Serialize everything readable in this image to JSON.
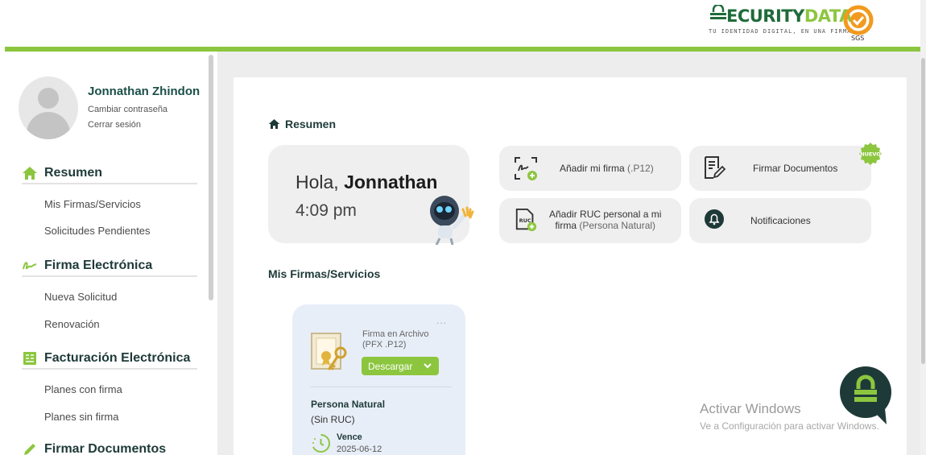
{
  "header": {
    "logo_part1": "ECURITY",
    "logo_part2": "DATA",
    "logo_tagline": "TU IDENTIDAD DIGITAL, EN UNA FIRMA.",
    "cert_badge": "SGS",
    "brand_green": "#8cc63f",
    "brand_dark": "#1f6b3a"
  },
  "user": {
    "name": "Jonnathan Zhindon",
    "change_password": "Cambiar contraseña",
    "logout": "Cerrar sesión"
  },
  "sidebar": {
    "sections": [
      {
        "label": "Resumen",
        "icon": "home-icon",
        "items": [
          "Mis Firmas/Servicios",
          "Solicitudes Pendientes"
        ]
      },
      {
        "label": "Firma Electrónica",
        "icon": "signature-icon",
        "items": [
          "Nueva Solicitud",
          "Renovación"
        ]
      },
      {
        "label": "Facturación Electrónica",
        "icon": "invoice-icon",
        "items": [
          "Planes con firma",
          "Planes sin firma"
        ]
      },
      {
        "label": "Firmar Documentos",
        "icon": "pencil-icon",
        "items": []
      }
    ]
  },
  "main": {
    "title": "Resumen",
    "greeting_prefix": "Hola,",
    "greeting_name": "Jonnathan",
    "time": "4:09 pm",
    "actions": {
      "add_signature": {
        "label": "Añadir mi firma",
        "suffix": "(.P12)",
        "icon": "add-signature-icon"
      },
      "sign_documents": {
        "label": "Firmar Documentos",
        "icon": "document-edit-icon",
        "badge": "NUEVO"
      },
      "add_ruc": {
        "label_line1": "Añadir RUC personal a mi",
        "label_line2_bold": "firma",
        "label_line2_thin": "(Persona Natural)",
        "icon": "ruc-document-icon"
      },
      "notifications": {
        "label": "Notificaciones",
        "icon": "bell-icon"
      }
    },
    "services_title": "Mis Firmas/Servicios",
    "service_card": {
      "menu": "...",
      "file_label_1": "Firma en Archivo",
      "file_label_2": "(PFX .P12)",
      "download_button": "Descargar",
      "type": "Persona Natural",
      "subtype": "(Sin RUC)",
      "expires_label": "Vence",
      "expires_date": "2025-06-12"
    }
  },
  "watermark": {
    "line1": "Activar Windows",
    "line2": "Ve a Configuración para activar Windows."
  }
}
